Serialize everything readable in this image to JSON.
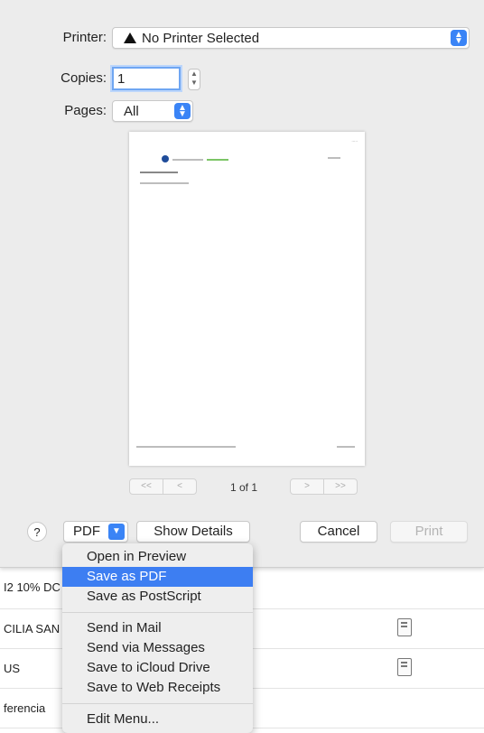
{
  "dialog": {
    "printer_label": "Printer:",
    "printer_value": "No Printer Selected",
    "copies_label": "Copies:",
    "copies_value": "1",
    "pages_label": "Pages:",
    "pages_value": "All",
    "page_count": "1 of 1",
    "help_label": "?",
    "pdf_label": "PDF",
    "show_details_label": "Show Details",
    "cancel_label": "Cancel",
    "print_label": "Print"
  },
  "pager": {
    "first": "<<",
    "prev": "<",
    "next": ">",
    "last": ">>"
  },
  "background_rows": [
    {
      "text": "I2 10% DC"
    },
    {
      "text": "CILIA SAN"
    },
    {
      "text": "US"
    },
    {
      "text": "ferencia"
    }
  ],
  "pdf_menu": {
    "items": [
      {
        "label": "Open in Preview"
      },
      {
        "label": "Save as PDF",
        "selected": true
      },
      {
        "label": "Save as PostScript"
      },
      {
        "label": "Send in Mail"
      },
      {
        "label": "Send via Messages"
      },
      {
        "label": "Save to iCloud Drive"
      },
      {
        "label": "Save to Web Receipts"
      },
      {
        "label": "Edit Menu..."
      }
    ]
  },
  "colors": {
    "accent": "#3a84f6",
    "selection": "#3d7ef2",
    "sheet_bg": "#ececec",
    "menu_bg": "#eeeeee"
  }
}
